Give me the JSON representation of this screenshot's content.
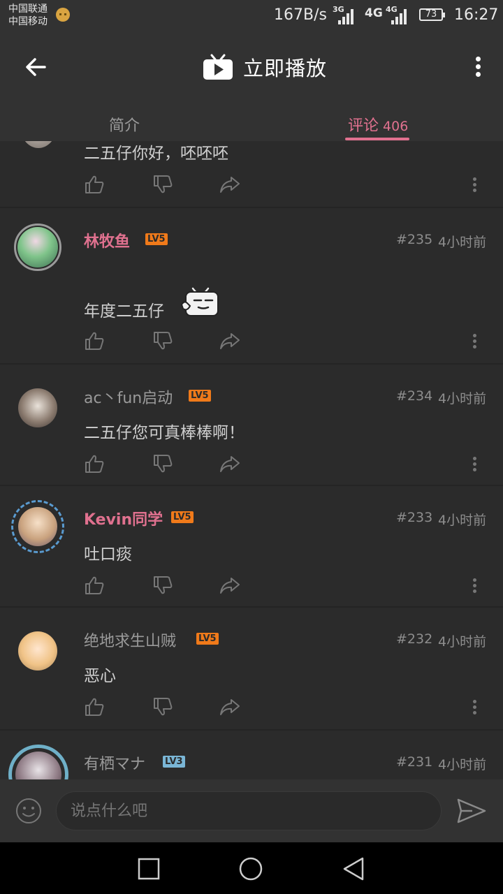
{
  "status_bar": {
    "carrier1": "中国联通",
    "carrier2": "中国移动",
    "speed": "167B/s",
    "sig1_tag": "3G",
    "sig2_tag": "4G",
    "sig3_tag": "4G",
    "battery": "73",
    "time": "16:27"
  },
  "app_bar": {
    "title": "立即播放",
    "back_icon": "arrow-left-icon",
    "title_icon": "tv-play-icon",
    "more_icon": "more-vertical-icon"
  },
  "tabs": [
    {
      "label": "简介",
      "active": false
    },
    {
      "label": "评论",
      "count": "406",
      "active": true
    }
  ],
  "comments": [
    {
      "partial": true,
      "text": "二五仔你好，呸呸呸"
    },
    {
      "user": "林牧鱼",
      "level": "LV5",
      "vip": true,
      "floor": "#235",
      "time": "4小时前",
      "text": "年度二五仔",
      "emoji": "tv-mascot-emoji"
    },
    {
      "user": "ac丶fun启动",
      "level": "LV5",
      "vip": false,
      "floor": "#234",
      "time": "4小时前",
      "text": "二五仔您可真棒棒啊！"
    },
    {
      "user": "Kevin同学",
      "level": "LV5",
      "vip": true,
      "floor": "#233",
      "time": "4小时前",
      "text": "吐口痰"
    },
    {
      "user": "绝地求生山贼",
      "level": "LV5",
      "vip": false,
      "floor": "#232",
      "time": "4小时前",
      "text": "恶心"
    },
    {
      "user": "有栖マナ",
      "level": "LV3",
      "vip": false,
      "floor": "#231",
      "time": "4小时前",
      "text": ""
    }
  ],
  "input_bar": {
    "placeholder": "说点什么吧",
    "emoji_icon": "smiley-icon",
    "send_icon": "send-icon"
  },
  "nav_bar": {
    "recents_icon": "square-icon",
    "home_icon": "circle-icon",
    "back_icon": "triangle-back-icon"
  },
  "colors": {
    "background": "#2b2b2b",
    "bar": "#323232",
    "accent_pink": "#e0718f",
    "level_orange": "#f07a1a",
    "level_blue": "#7ab6d6"
  }
}
